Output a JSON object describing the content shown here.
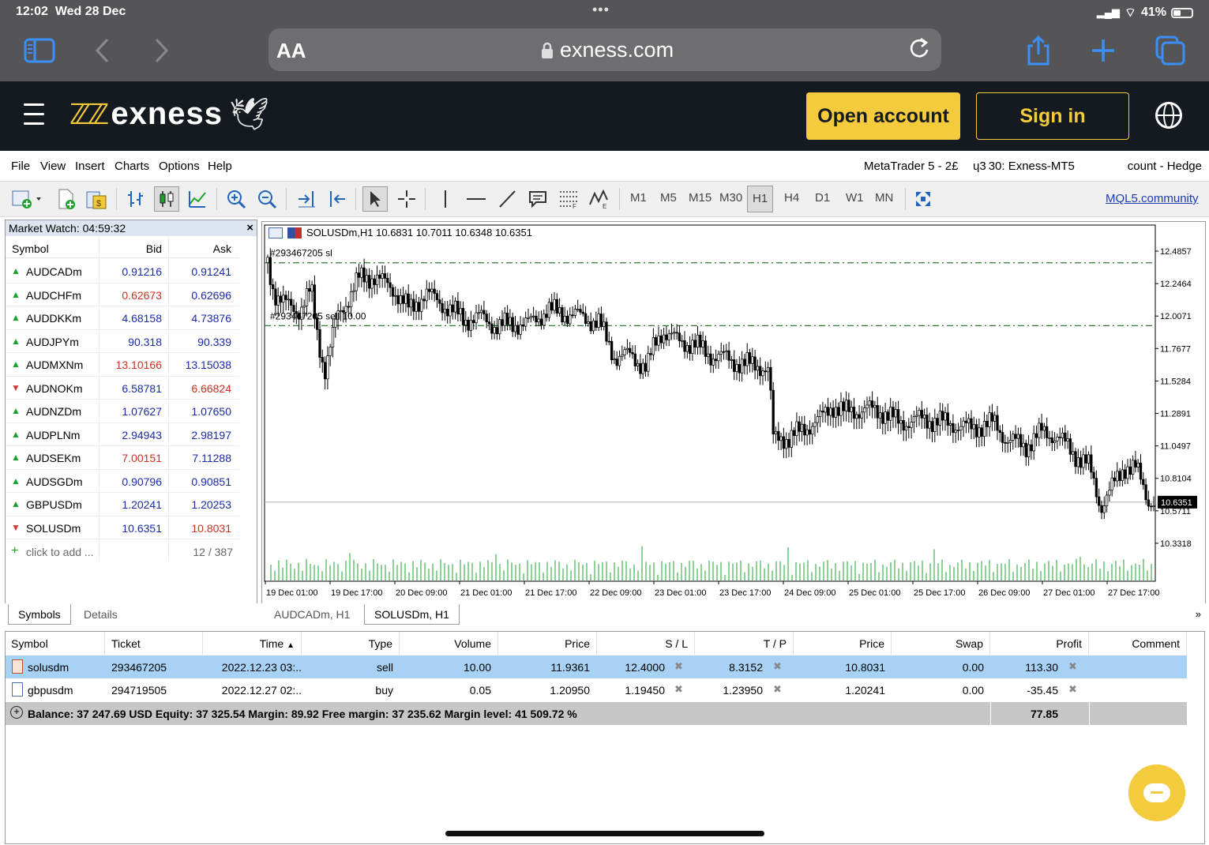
{
  "status_bar": {
    "time": "12:02",
    "date": "Wed 28 Dec",
    "battery": "41%"
  },
  "safari": {
    "aa": "AA",
    "url": "exness.com"
  },
  "site_header": {
    "logo": "exness",
    "open_account": "Open account",
    "sign_in": "Sign in"
  },
  "menu": {
    "items": [
      "File",
      "View",
      "Insert",
      "Charts",
      "Options",
      "Help"
    ],
    "right_1": "MetaTrader 5 - 2£",
    "right_2": "ɥ3 30: Exness-MT5",
    "right_3": "count - Hedge"
  },
  "toolbar": {
    "timeframes": [
      "M1",
      "M5",
      "M15",
      "M30",
      "H1",
      "H4",
      "D1",
      "W1",
      "MN"
    ],
    "active_timeframe": "H1",
    "community_link": "MQL5.community"
  },
  "market_watch": {
    "title": "Market Watch: 04:59:32",
    "headers": {
      "symbol": "Symbol",
      "bid": "Bid",
      "ask": "Ask"
    },
    "rows": [
      {
        "symbol": "AUDCADm",
        "bid": "0.91216",
        "ask": "0.91241",
        "dir": "up",
        "bid_color": "blue",
        "ask_color": "blue"
      },
      {
        "symbol": "AUDCHFm",
        "bid": "0.62673",
        "ask": "0.62696",
        "dir": "up",
        "bid_color": "red",
        "ask_color": "blue"
      },
      {
        "symbol": "AUDDKKm",
        "bid": "4.68158",
        "ask": "4.73876",
        "dir": "up",
        "bid_color": "blue",
        "ask_color": "blue"
      },
      {
        "symbol": "AUDJPYm",
        "bid": "90.318",
        "ask": "90.339",
        "dir": "up",
        "bid_color": "blue",
        "ask_color": "blue"
      },
      {
        "symbol": "AUDMXNm",
        "bid": "13.10166",
        "ask": "13.15038",
        "dir": "up",
        "bid_color": "red",
        "ask_color": "blue"
      },
      {
        "symbol": "AUDNOKm",
        "bid": "6.58781",
        "ask": "6.66824",
        "dir": "down",
        "bid_color": "blue",
        "ask_color": "red"
      },
      {
        "symbol": "AUDNZDm",
        "bid": "1.07627",
        "ask": "1.07650",
        "dir": "up",
        "bid_color": "blue",
        "ask_color": "blue"
      },
      {
        "symbol": "AUDPLNm",
        "bid": "2.94943",
        "ask": "2.98197",
        "dir": "up",
        "bid_color": "blue",
        "ask_color": "blue"
      },
      {
        "symbol": "AUDSEKm",
        "bid": "7.00151",
        "ask": "7.11288",
        "dir": "up",
        "bid_color": "red",
        "ask_color": "blue"
      },
      {
        "symbol": "AUDSGDm",
        "bid": "0.90796",
        "ask": "0.90851",
        "dir": "up",
        "bid_color": "blue",
        "ask_color": "blue"
      },
      {
        "symbol": "GBPUSDm",
        "bid": "1.20241",
        "ask": "1.20253",
        "dir": "up",
        "bid_color": "blue",
        "ask_color": "blue"
      },
      {
        "symbol": "SOLUSDm",
        "bid": "10.6351",
        "ask": "10.8031",
        "dir": "down",
        "bid_color": "blue",
        "ask_color": "red"
      }
    ],
    "add_label": "click to add ...",
    "count": "12 / 387"
  },
  "chart": {
    "header": "SOLUSDm,H1  10.6831 10.7011 10.6348 10.6351",
    "sl_label": "#293467205 sl",
    "order_label": "#293467205 sell 10.00",
    "current_price": "10.6351",
    "price_axis": [
      "12.4857",
      "12.2464",
      "12.0071",
      "11.7677",
      "11.5284",
      "11.2891",
      "11.0497",
      "10.8104",
      "10.5711",
      "10.3318"
    ],
    "time_axis": [
      "19 Dec 01:00",
      "19 Dec 17:00",
      "20 Dec 09:00",
      "21 Dec 01:00",
      "21 Dec 17:00",
      "22 Dec 09:00",
      "23 Dec 01:00",
      "23 Dec 17:00",
      "24 Dec 09:00",
      "25 Dec 01:00",
      "25 Dec 17:00",
      "26 Dec 09:00",
      "27 Dec 01:00",
      "27 Dec 17:00"
    ]
  },
  "chart_data": {
    "type": "candlestick",
    "symbol": "SOLUSDm",
    "timeframe": "H1",
    "ylim": [
      10.2,
      12.6
    ],
    "levels": {
      "stop_loss": 12.4,
      "order_price": 11.9361,
      "last": 10.6351
    },
    "path": [
      [
        0,
        12.4
      ],
      [
        8,
        12.18
      ],
      [
        20,
        12.1
      ],
      [
        40,
        12.05
      ],
      [
        55,
        12.2
      ],
      [
        62,
        11.9
      ],
      [
        72,
        11.6
      ],
      [
        88,
        12.0
      ],
      [
        100,
        12.12
      ],
      [
        115,
        12.28
      ],
      [
        135,
        12.3
      ],
      [
        160,
        12.2
      ],
      [
        180,
        12.05
      ],
      [
        200,
        12.18
      ],
      [
        220,
        12.1
      ],
      [
        250,
        11.98
      ],
      [
        270,
        12.0
      ],
      [
        290,
        11.93
      ],
      [
        310,
        11.95
      ],
      [
        330,
        11.95
      ],
      [
        355,
        12.05
      ],
      [
        380,
        12.02
      ],
      [
        400,
        12.0
      ],
      [
        420,
        11.95
      ],
      [
        440,
        11.7
      ],
      [
        460,
        11.72
      ],
      [
        480,
        11.62
      ],
      [
        490,
        11.8
      ],
      [
        500,
        11.9
      ],
      [
        520,
        11.82
      ],
      [
        540,
        11.8
      ],
      [
        560,
        11.72
      ],
      [
        580,
        11.7
      ],
      [
        600,
        11.65
      ],
      [
        620,
        11.65
      ],
      [
        635,
        11.6
      ],
      [
        640,
        11.1
      ],
      [
        650,
        11.12
      ],
      [
        660,
        11.1
      ],
      [
        680,
        11.18
      ],
      [
        700,
        11.25
      ],
      [
        715,
        11.35
      ],
      [
        730,
        11.3
      ],
      [
        760,
        11.32
      ],
      [
        780,
        11.3
      ],
      [
        800,
        11.22
      ],
      [
        830,
        11.25
      ],
      [
        860,
        11.22
      ],
      [
        890,
        11.18
      ],
      [
        920,
        11.22
      ],
      [
        935,
        11.1
      ],
      [
        960,
        11.05
      ],
      [
        980,
        11.15
      ],
      [
        1000,
        11.12
      ],
      [
        1020,
        11.0
      ],
      [
        1040,
        10.9
      ],
      [
        1055,
        10.6
      ],
      [
        1070,
        10.75
      ],
      [
        1085,
        10.9
      ],
      [
        1100,
        10.88
      ],
      [
        1115,
        10.65
      ],
      [
        1125,
        10.635
      ]
    ]
  },
  "tabs": {
    "symbols": "Symbols",
    "details": "Details",
    "chart1": "AUDCADm, H1",
    "chart2": "SOLUSDm, H1",
    "more": "»"
  },
  "trades": {
    "headers": [
      "Symbol",
      "Ticket",
      "Time",
      "Type",
      "Volume",
      "Price",
      "S / L",
      "T / P",
      "Price",
      "Swap",
      "Profit",
      "Comment"
    ],
    "rows": [
      {
        "symbol": "solusdm",
        "ticket": "293467205",
        "time": "2022.12.23 03:..",
        "type": "sell",
        "volume": "10.00",
        "price": "11.9361",
        "sl": "12.4000",
        "tp": "8.3152",
        "cur_price": "10.8031",
        "swap": "0.00",
        "profit": "113.30",
        "comment": ""
      },
      {
        "symbol": "gbpusdm",
        "ticket": "294719505",
        "time": "2022.12.27 02:..",
        "type": "buy",
        "volume": "0.05",
        "price": "1.20950",
        "sl": "1.19450",
        "tp": "1.23950",
        "cur_price": "1.20241",
        "swap": "0.00",
        "profit": "-35.45",
        "comment": ""
      }
    ],
    "balance_line": "Balance: 37 247.69 USD  Equity: 37 325.54  Margin: 89.92  Free margin: 37 235.62  Margin level: 41 509.72 %",
    "total_profit": "77.85"
  }
}
